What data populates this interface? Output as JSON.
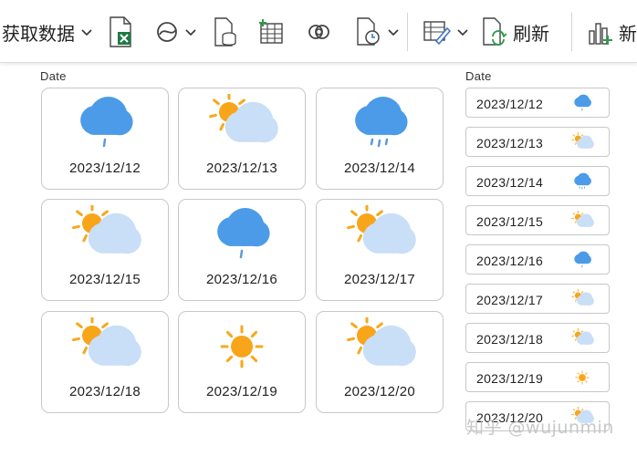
{
  "toolbar": {
    "get_data_label": "获取数据",
    "refresh_label": "刷新",
    "new_label": "新",
    "icons": [
      "excel-icon",
      "onelake-icon",
      "dataverse-icon",
      "table-icon",
      "dataflow-icon",
      "recent-sources-icon",
      "transform-icon",
      "refresh-icon",
      "new-visual-icon"
    ]
  },
  "grid": {
    "label": "Date",
    "cards": [
      {
        "date": "2023/12/12",
        "weather": "rain-light"
      },
      {
        "date": "2023/12/13",
        "weather": "partly-cloudy"
      },
      {
        "date": "2023/12/14",
        "weather": "rain"
      },
      {
        "date": "2023/12/15",
        "weather": "partly-cloudy"
      },
      {
        "date": "2023/12/16",
        "weather": "rain-light"
      },
      {
        "date": "2023/12/17",
        "weather": "partly-cloudy"
      },
      {
        "date": "2023/12/18",
        "weather": "partly-cloudy"
      },
      {
        "date": "2023/12/19",
        "weather": "sunny"
      },
      {
        "date": "2023/12/20",
        "weather": "partly-cloudy"
      }
    ]
  },
  "list": {
    "label": "Date",
    "rows": [
      {
        "date": "2023/12/12",
        "weather": "rain-light"
      },
      {
        "date": "2023/12/13",
        "weather": "partly-cloudy"
      },
      {
        "date": "2023/12/14",
        "weather": "rain"
      },
      {
        "date": "2023/12/15",
        "weather": "partly-cloudy"
      },
      {
        "date": "2023/12/16",
        "weather": "rain-light"
      },
      {
        "date": "2023/12/17",
        "weather": "partly-cloudy"
      },
      {
        "date": "2023/12/18",
        "weather": "partly-cloudy"
      },
      {
        "date": "2023/12/19",
        "weather": "sunny"
      },
      {
        "date": "2023/12/20",
        "weather": "partly-cloudy"
      }
    ]
  },
  "watermark": "知乎 @wujunmin",
  "colors": {
    "sun": "#f9a51a",
    "sun_ray": "#f7a81b",
    "cloud_blue": "#4b9be8",
    "cloud_light": "#c9def7",
    "rain": "#5c9bd6"
  }
}
